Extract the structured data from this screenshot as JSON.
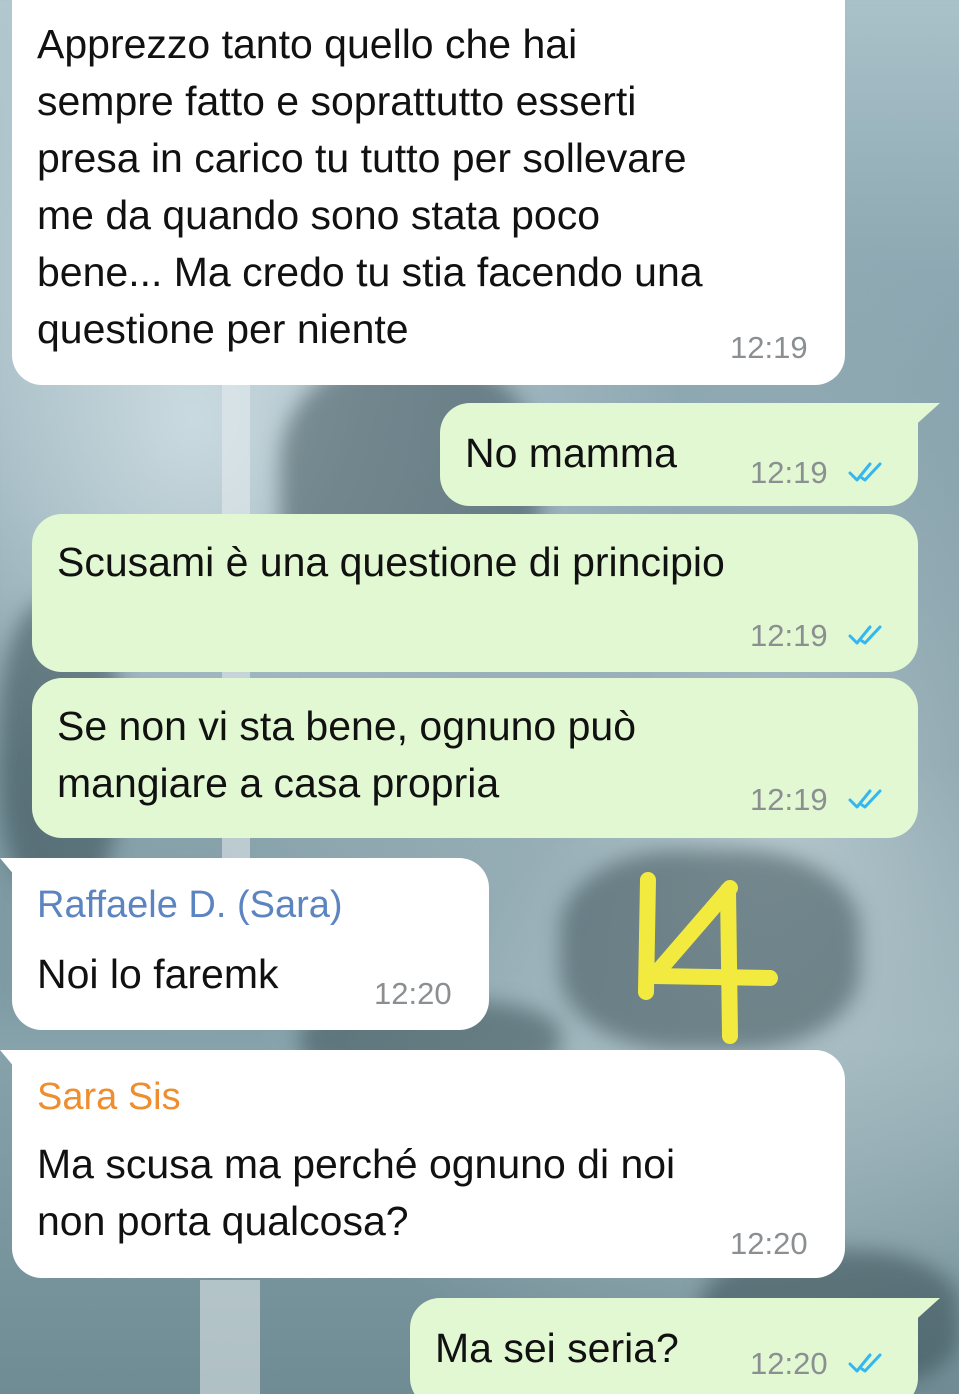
{
  "messages": [
    {
      "text": "Apprezzo tanto quello che hai\nsempre fatto e soprattutto esserti\npresa in carico tu tutto per sollevare\nme da quando sono stata poco\nbene... Ma credo tu stia facendo una\nquestione per niente",
      "time": "12:19"
    },
    {
      "text": "No mamma",
      "time": "12:19"
    },
    {
      "text": "Scusami è una questione di principio",
      "time": "12:19"
    },
    {
      "text": "Se non vi sta bene, ognuno può\nmangiare a casa propria",
      "time": "12:19"
    },
    {
      "sender": "Raffaele D. (Sara)",
      "text": "Noi lo faremk",
      "time": "12:20"
    },
    {
      "sender": "Sara Sis",
      "text": "Ma scusa ma perché ognuno di noi\nnon porta qualcosa?",
      "time": "12:20"
    },
    {
      "text": "Ma sei seria?",
      "time": "12:20"
    }
  ],
  "annotation": {
    "text": "14",
    "color": "#f2ea3e"
  },
  "colors": {
    "incoming_bubble": "#ffffff",
    "outgoing_bubble": "#e1f8d2",
    "read_ticks": "#34b7f1",
    "sender_raffaele": "#5c84c1",
    "sender_sara": "#ee8e2f",
    "timestamp": "#8b8f91"
  },
  "icons": [
    "double-check-read-icon"
  ]
}
